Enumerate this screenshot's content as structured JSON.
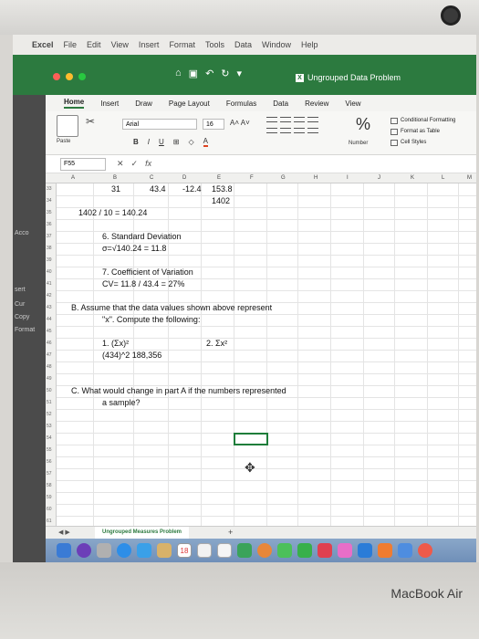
{
  "menubar": {
    "app": "Excel",
    "items": [
      "File",
      "Edit",
      "View",
      "Insert",
      "Format",
      "Tools",
      "Data",
      "Window",
      "Help"
    ]
  },
  "window": {
    "title": "Ungrouped Data Problem"
  },
  "ribbon": {
    "tabs": [
      "Home",
      "Insert",
      "Draw",
      "Page Layout",
      "Formulas",
      "Data",
      "Review",
      "View"
    ],
    "active_tab": "Home",
    "font_name": "Arial",
    "font_size": "16",
    "paste_label": "Paste",
    "number_label": "Number",
    "conditional_formatting": "Conditional Formatting",
    "format_as_table": "Format as Table",
    "cell_styles": "Cell Styles"
  },
  "formula_bar": {
    "name_box": "F55",
    "fx": "fx"
  },
  "left_strip": {
    "acco": "Acco",
    "sert": "sert",
    "cur": "Cur",
    "copy": "Copy",
    "format": "Format"
  },
  "columns": [
    "A",
    "B",
    "C",
    "D",
    "E",
    "F",
    "G",
    "H",
    "I",
    "J",
    "K",
    "L",
    "M"
  ],
  "rows": [
    "33",
    "34",
    "35",
    "36",
    "37",
    "38",
    "39",
    "40",
    "41",
    "42",
    "43",
    "44",
    "45",
    "46",
    "47",
    "48",
    "49",
    "50",
    "51",
    "52",
    "53",
    "54",
    "55",
    "56",
    "57",
    "58",
    "59",
    "60",
    "61"
  ],
  "cells": {
    "b33": "31",
    "c33": "43.4",
    "d33": "-12.4",
    "e33": "153.8",
    "e34": "1402",
    "a35": "1402 / 10 = 140.24",
    "b37": "6. Standard Deviation",
    "b38": "σ=√140.24 = 11.8",
    "b40": "7. Coefficient of Variation",
    "b41": "CV= 11.8 / 43.4 = 27%",
    "a43": "B. Assume that the data values shown above represent",
    "a44": "\"x\". Compute the following:",
    "b46": "1. (Σx)²",
    "d46": "2. Σx²",
    "b47": "(434)^2 188,356",
    "a50": "C. What would change in part A if the numbers represented",
    "a51": "a sample?"
  },
  "sheet_tab": "Ungrouped Measures Problem",
  "dock": {
    "calendar_day": "18"
  },
  "device_brand": "MacBook Air"
}
